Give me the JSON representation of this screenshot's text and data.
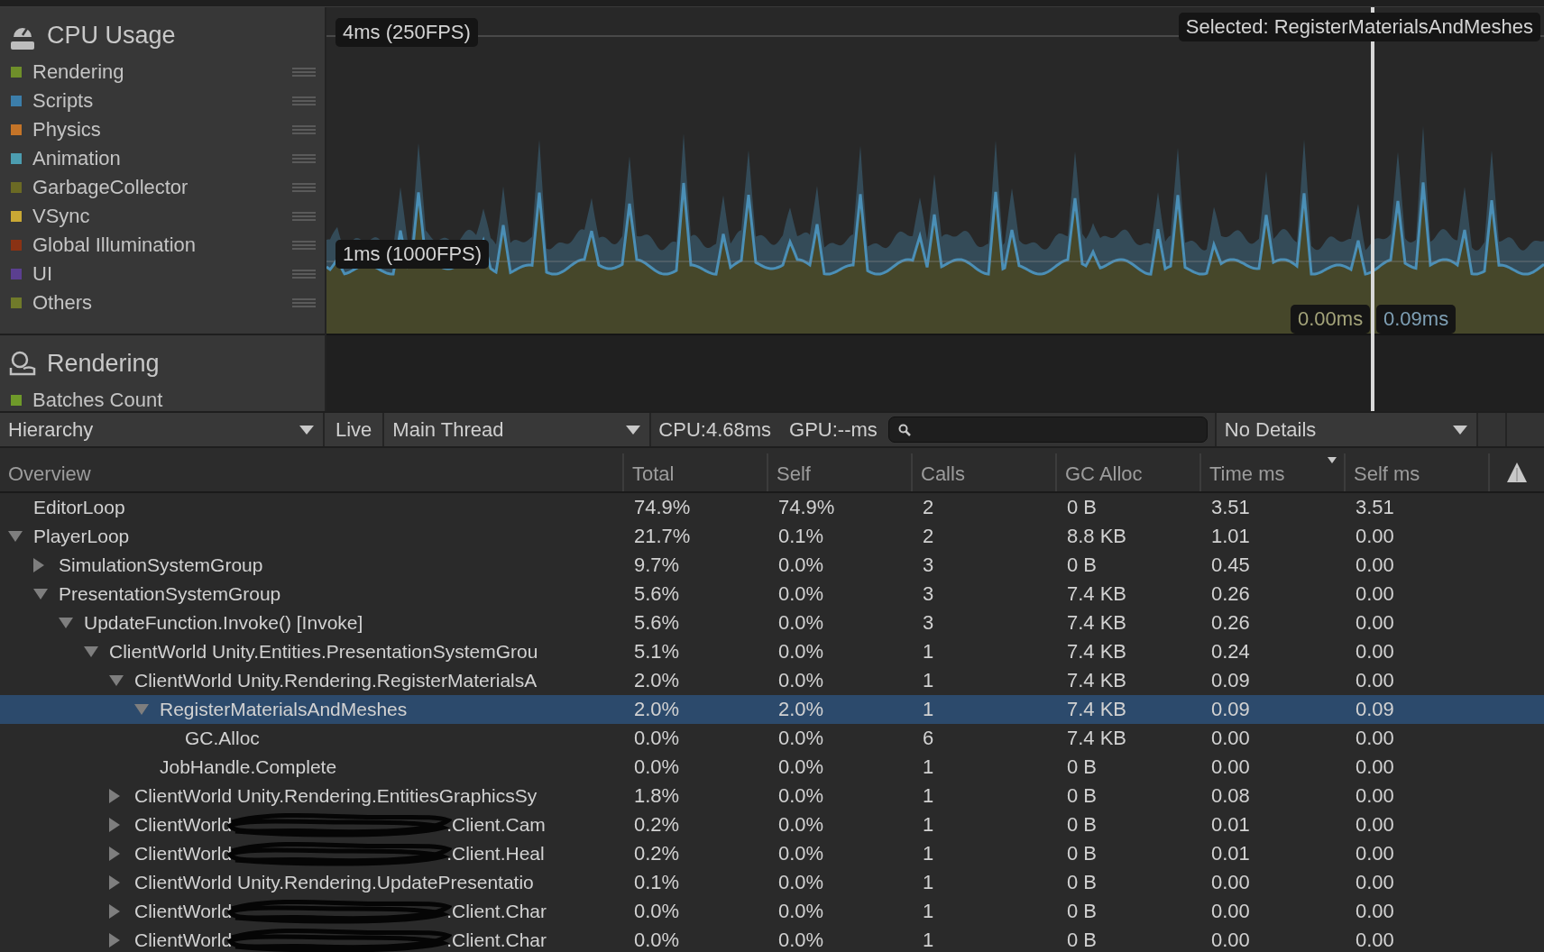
{
  "modules": [
    {
      "title": "CPU Usage",
      "kind": "cpu",
      "legend": [
        {
          "label": "Rendering",
          "color": "#6f8f2a"
        },
        {
          "label": "Scripts",
          "color": "#3c7eaa"
        },
        {
          "label": "Physics",
          "color": "#c47428"
        },
        {
          "label": "Animation",
          "color": "#4c9db0"
        },
        {
          "label": "GarbageCollector",
          "color": "#6b6a24"
        },
        {
          "label": "VSync",
          "color": "#c9a834"
        },
        {
          "label": "Global Illumination",
          "color": "#8a3214"
        },
        {
          "label": "UI",
          "color": "#5b3f90"
        },
        {
          "label": "Others",
          "color": "#707a2a"
        }
      ]
    },
    {
      "title": "Rendering",
      "kind": "rendering",
      "legend": [
        {
          "label": "Batches Count",
          "color": "#6f9a2a"
        }
      ]
    }
  ],
  "chart_labels": {
    "upper": "4ms (250FPS)",
    "lower": "1ms (1000FPS)",
    "selected": "Selected: RegisterMaterialsAndMeshes",
    "cursor_left": "0.00ms",
    "cursor_right": "0.09ms"
  },
  "toolbar": {
    "view": "Hierarchy",
    "live": "Live",
    "thread": "Main Thread",
    "cpu": "CPU:4.68ms",
    "gpu": "GPU:--ms",
    "details": "No Details"
  },
  "table": {
    "columns": [
      {
        "label": "Overview",
        "sorted": false
      },
      {
        "label": "Total",
        "sorted": false
      },
      {
        "label": "Self",
        "sorted": false
      },
      {
        "label": "Calls",
        "sorted": false
      },
      {
        "label": "GC Alloc",
        "sorted": false
      },
      {
        "label": "Time ms",
        "sorted": true
      },
      {
        "label": "Self ms",
        "sorted": false
      }
    ],
    "rows": [
      {
        "name": "EditorLoop",
        "values": [
          "74.9%",
          "74.9%",
          "2",
          "0 B",
          "3.51",
          "3.51"
        ],
        "selected": false
      },
      {
        "name": "PlayerLoop",
        "values": [
          "21.7%",
          "0.1%",
          "2",
          "8.8 KB",
          "1.01",
          "0.00"
        ],
        "selected": false,
        "expanded": true,
        "children": [
          {
            "name": "SimulationSystemGroup",
            "values": [
              "9.7%",
              "0.0%",
              "3",
              "0 B",
              "0.45",
              "0.00"
            ],
            "selected": false,
            "expanded": false
          },
          {
            "name": "PresentationSystemGroup",
            "values": [
              "5.6%",
              "0.0%",
              "3",
              "7.4 KB",
              "0.26",
              "0.00"
            ],
            "selected": false,
            "expanded": true,
            "children": [
              {
                "name": "UpdateFunction.Invoke() [Invoke]",
                "values": [
                  "5.6%",
                  "0.0%",
                  "3",
                  "7.4 KB",
                  "0.26",
                  "0.00"
                ],
                "selected": false,
                "expanded": true,
                "children": [
                  {
                    "name": "ClientWorld Unity.Entities.PresentationSystemGrou",
                    "values": [
                      "5.1%",
                      "0.0%",
                      "1",
                      "7.4 KB",
                      "0.24",
                      "0.00"
                    ],
                    "selected": false,
                    "expanded": true,
                    "children": [
                      {
                        "name": "ClientWorld Unity.Rendering.RegisterMaterialsA",
                        "values": [
                          "2.0%",
                          "0.0%",
                          "1",
                          "7.4 KB",
                          "0.09",
                          "0.00"
                        ],
                        "selected": false,
                        "expanded": true,
                        "children": [
                          {
                            "name": "RegisterMaterialsAndMeshes",
                            "values": [
                              "2.0%",
                              "2.0%",
                              "1",
                              "7.4 KB",
                              "0.09",
                              "0.09"
                            ],
                            "selected": true,
                            "expanded": true,
                            "children": [
                              {
                                "name": "GC.Alloc",
                                "values": [
                                  "0.0%",
                                  "0.0%",
                                  "6",
                                  "7.4 KB",
                                  "0.00",
                                  "0.00"
                                ],
                                "selected": false
                              }
                            ]
                          },
                          {
                            "name": "JobHandle.Complete",
                            "values": [
                              "0.0%",
                              "0.0%",
                              "1",
                              "0 B",
                              "0.00",
                              "0.00"
                            ],
                            "selected": false
                          }
                        ]
                      },
                      {
                        "name": "ClientWorld Unity.Rendering.EntitiesGraphicsSy",
                        "values": [
                          "1.8%",
                          "0.0%",
                          "1",
                          "0 B",
                          "0.08",
                          "0.00"
                        ],
                        "selected": false,
                        "expanded": false
                      },
                      {
                        "name": "ClientWorld",
                        "name_end": ".Client.Cam",
                        "values": [
                          "0.2%",
                          "0.0%",
                          "1",
                          "0 B",
                          "0.01",
                          "0.00"
                        ],
                        "selected": false,
                        "expanded": false
                      },
                      {
                        "name": "ClientWorld",
                        "name_end": ".Client.Heal",
                        "values": [
                          "0.2%",
                          "0.0%",
                          "1",
                          "0 B",
                          "0.01",
                          "0.00"
                        ],
                        "selected": false,
                        "expanded": false
                      },
                      {
                        "name": "ClientWorld Unity.Rendering.UpdatePresentatio",
                        "values": [
                          "0.1%",
                          "0.0%",
                          "1",
                          "0 B",
                          "0.00",
                          "0.00"
                        ],
                        "selected": false,
                        "expanded": false
                      },
                      {
                        "name": "ClientWorld",
                        "name_end": ".Client.Char",
                        "values": [
                          "0.0%",
                          "0.0%",
                          "1",
                          "0 B",
                          "0.00",
                          "0.00"
                        ],
                        "selected": false,
                        "expanded": false
                      },
                      {
                        "name": "ClientWorld",
                        "name_end": ".Client.Char",
                        "values": [
                          "0.0%",
                          "0.0%",
                          "1",
                          "0 B",
                          "0.00",
                          "0.00"
                        ],
                        "selected": false,
                        "expanded": false
                      }
                    ]
                  }
                ]
              }
            ]
          }
        ]
      }
    ]
  }
}
